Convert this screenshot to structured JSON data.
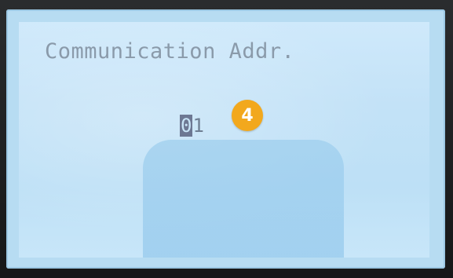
{
  "screen": {
    "title": "Communication Addr.",
    "value": {
      "cursor_digit": "0",
      "remaining_digits": "1"
    }
  },
  "annotation": {
    "step_number": "4",
    "badge_color": "#f2a81d"
  },
  "colors": {
    "lcd_background": "#c3e2f7",
    "lcd_text": "#8a9aaa",
    "cursor_highlight": "#6d7893"
  }
}
